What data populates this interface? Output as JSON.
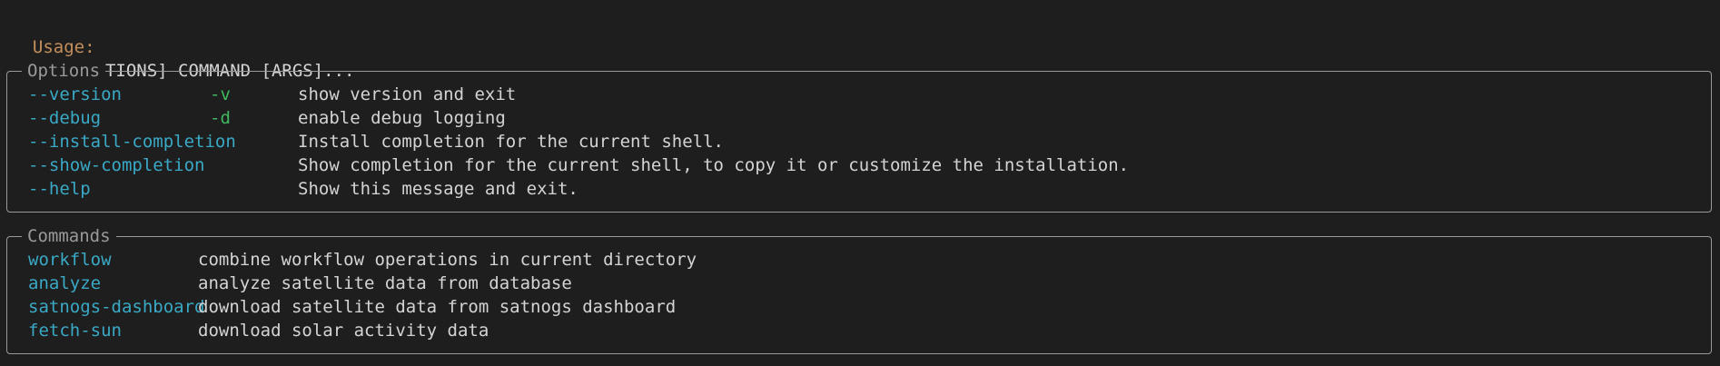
{
  "usage": {
    "label": "Usage:",
    "text": "ast [OPTIONS] COMMAND [ARGS]..."
  },
  "options_panel": {
    "title": "Options",
    "rows": [
      {
        "flag": "--version",
        "short": "-v",
        "desc": "show version and exit"
      },
      {
        "flag": "--debug",
        "short": "-d",
        "desc": "enable debug logging"
      },
      {
        "flag": "--install-completion",
        "short": "",
        "desc": "Install completion for the current shell."
      },
      {
        "flag": "--show-completion",
        "short": "",
        "desc": "Show completion for the current shell, to copy it or customize the installation."
      },
      {
        "flag": "--help",
        "short": "",
        "desc": "Show this message and exit."
      }
    ]
  },
  "commands_panel": {
    "title": "Commands",
    "rows": [
      {
        "name": "workflow",
        "desc": "combine workflow operations in current directory"
      },
      {
        "name": "analyze",
        "desc": "analyze satellite data from database"
      },
      {
        "name": "satnogs-dashboard",
        "desc": "download satellite data from satnogs dashboard"
      },
      {
        "name": "fetch-sun",
        "desc": "download solar activity data"
      }
    ]
  },
  "colors": {
    "background": "#1e1e1e",
    "usage_label": "#c38f5b",
    "option_flag": "#3aa9c6",
    "short_flag": "#3fb85f",
    "text": "#d4d4d4",
    "border": "#9a9a9a"
  }
}
